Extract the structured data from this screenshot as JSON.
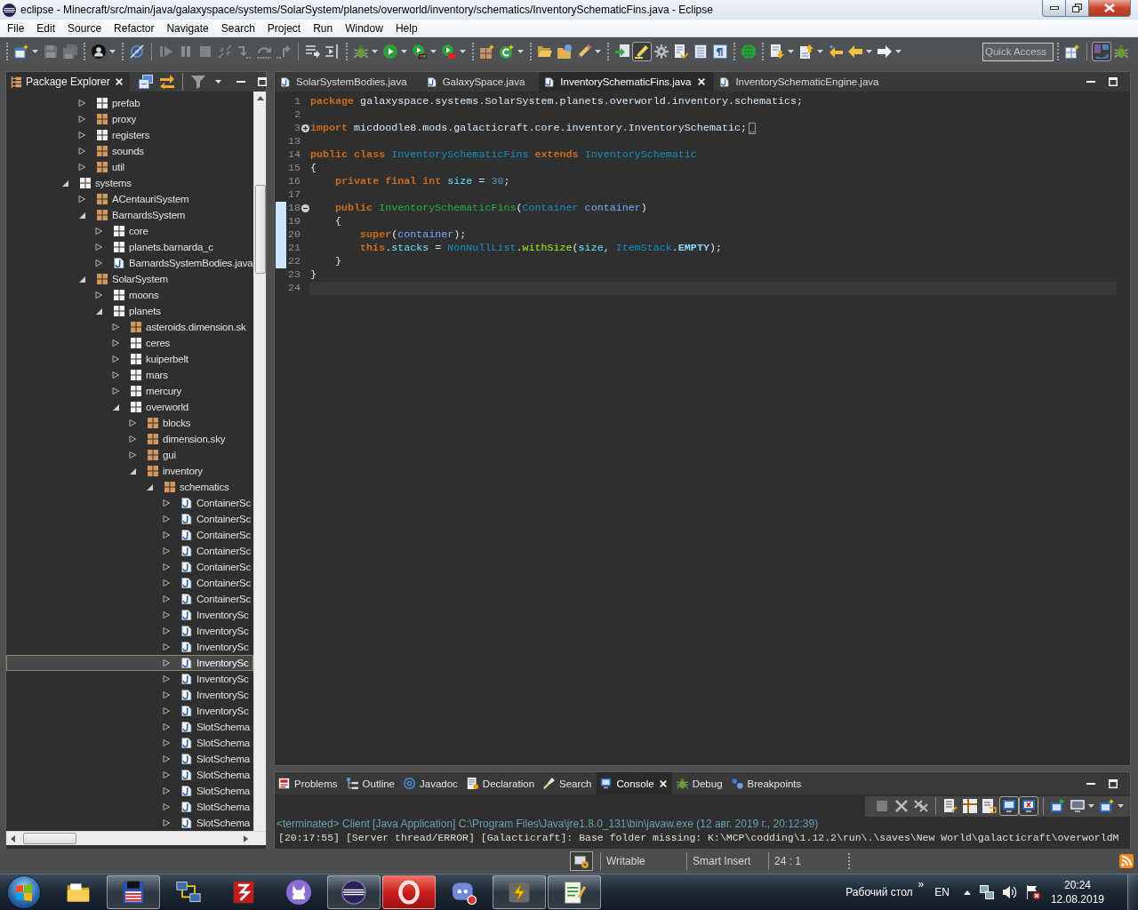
{
  "window": {
    "title": "eclipse - Minecraft/src/main/java/galaxyspace/systems/SolarSystem/planets/overworld/inventory/schematics/InventorySchematicFins.java - Eclipse"
  },
  "menu": [
    "File",
    "Edit",
    "Source",
    "Refactor",
    "Navigate",
    "Search",
    "Project",
    "Run",
    "Window",
    "Help"
  ],
  "toolbar": {
    "groups": [
      {
        "sections": [
          [
            {
              "kind": "newwizard",
              "disabled": false,
              "pressed": false,
              "dropdown": true
            },
            {
              "kind": "save",
              "disabled": true,
              "pressed": false,
              "dropdown": false
            },
            {
              "kind": "saveall",
              "disabled": true,
              "pressed": false,
              "dropdown": false
            }
          ]
        ]
      },
      {
        "sections": [
          [
            {
              "kind": "profile",
              "disabled": false,
              "pressed": false,
              "dropdown": true
            }
          ]
        ]
      },
      {
        "sections": [
          [
            {
              "kind": "skip",
              "disabled": false,
              "pressed": false,
              "dropdown": false
            }
          ],
          [
            {
              "kind": "resume",
              "disabled": true,
              "pressed": false,
              "dropdown": false
            },
            {
              "kind": "suspend",
              "disabled": true,
              "pressed": false,
              "dropdown": false
            },
            {
              "kind": "terminate",
              "disabled": true,
              "pressed": false,
              "dropdown": false
            },
            {
              "kind": "disconnect",
              "disabled": true,
              "pressed": false,
              "dropdown": false
            },
            {
              "kind": "stepinto",
              "disabled": true,
              "pressed": false,
              "dropdown": false
            },
            {
              "kind": "stepover",
              "disabled": true,
              "pressed": false,
              "dropdown": false
            },
            {
              "kind": "stepreturn",
              "disabled": true,
              "pressed": false,
              "dropdown": false
            }
          ],
          [
            {
              "kind": "dropframe",
              "disabled": false,
              "pressed": false,
              "dropdown": false
            },
            {
              "kind": "stepfilter",
              "disabled": false,
              "pressed": false,
              "dropdown": false
            }
          ]
        ]
      },
      {
        "sections": [
          [
            {
              "kind": "debug",
              "disabled": false,
              "pressed": false,
              "dropdown": true
            },
            {
              "kind": "run",
              "disabled": false,
              "pressed": false,
              "dropdown": true
            },
            {
              "kind": "coverage",
              "disabled": false,
              "pressed": false,
              "dropdown": true
            },
            {
              "kind": "external",
              "disabled": false,
              "pressed": false,
              "dropdown": true
            }
          ]
        ]
      },
      {
        "sections": [
          [
            {
              "kind": "newpackage",
              "disabled": false,
              "pressed": false,
              "dropdown": false
            },
            {
              "kind": "newclass",
              "disabled": false,
              "pressed": false,
              "dropdown": true
            }
          ]
        ]
      },
      {
        "sections": [
          [
            {
              "kind": "openfolder",
              "disabled": false,
              "pressed": false,
              "dropdown": false
            },
            {
              "kind": "opentype",
              "disabled": false,
              "pressed": false,
              "dropdown": false
            },
            {
              "kind": "pencil",
              "disabled": false,
              "pressed": false,
              "dropdown": true
            }
          ]
        ]
      },
      {
        "sections": [
          [
            {
              "kind": "breadcrumb",
              "disabled": false,
              "pressed": false,
              "dropdown": false
            },
            {
              "kind": "highlighter",
              "disabled": false,
              "pressed": true,
              "dropdown": false
            },
            {
              "kind": "blocks",
              "disabled": false,
              "pressed": false,
              "dropdown": false
            },
            {
              "kind": "doc",
              "disabled": false,
              "pressed": false,
              "dropdown": false
            },
            {
              "kind": "pagecolumns",
              "disabled": false,
              "pressed": false,
              "dropdown": false
            },
            {
              "kind": "paragraph",
              "disabled": false,
              "pressed": false,
              "dropdown": false
            }
          ]
        ]
      },
      {
        "sections": [
          [
            {
              "kind": "globe",
              "disabled": false,
              "pressed": false,
              "dropdown": false
            }
          ]
        ]
      },
      {
        "sections": [
          [
            {
              "kind": "nextann",
              "disabled": false,
              "pressed": false,
              "dropdown": true
            },
            {
              "kind": "prevann",
              "disabled": false,
              "pressed": false,
              "dropdown": true
            },
            {
              "kind": "lastedit",
              "disabled": false,
              "pressed": false,
              "dropdown": false
            },
            {
              "kind": "back",
              "disabled": false,
              "pressed": false,
              "dropdown": true
            },
            {
              "kind": "forward",
              "disabled": false,
              "pressed": false,
              "dropdown": true
            }
          ]
        ]
      }
    ],
    "quick_access": {
      "placeholder": "Quick Access"
    },
    "perspectives": [
      {
        "sections": [
          [
            {
              "kind": "perspective",
              "disabled": false,
              "pressed": false,
              "dropdown": false
            }
          ],
          [
            {
              "kind": "javaperspective",
              "disabled": false,
              "pressed": true,
              "dropdown": false
            },
            {
              "kind": "debugperspective",
              "disabled": false,
              "pressed": false,
              "dropdown": false
            }
          ]
        ]
      }
    ]
  },
  "package_explorer": {
    "title": "Package Explorer",
    "continued_items": [
      {
        "label": "prefab",
        "kind": "empty",
        "expanded": false,
        "selected": false
      },
      {
        "label": "proxy",
        "kind": "package",
        "expanded": false,
        "selected": false
      },
      {
        "label": "registers",
        "kind": "empty",
        "expanded": false,
        "selected": false
      },
      {
        "label": "sounds",
        "kind": "package",
        "expanded": false,
        "selected": false
      },
      {
        "label": "util",
        "kind": "package",
        "expanded": false,
        "selected": false
      }
    ],
    "tree": [
      {
        "label": "systems",
        "kind": "empty",
        "expanded": true,
        "selected": false,
        "children": [
          {
            "label": "ACentauriSystem",
            "kind": "package",
            "expanded": false,
            "selected": false
          },
          {
            "label": "BarnardsSystem",
            "kind": "package",
            "expanded": true,
            "selected": false,
            "children": [
              {
                "label": "core",
                "kind": "empty",
                "expanded": false,
                "selected": false
              },
              {
                "label": "planets.barnarda_c",
                "kind": "empty",
                "expanded": false,
                "selected": false
              },
              {
                "label": "BarnardsSystemBodies.java",
                "kind": "file",
                "expanded": false,
                "selected": false
              }
            ]
          },
          {
            "label": "SolarSystem",
            "kind": "package",
            "expanded": true,
            "selected": false,
            "children": [
              {
                "label": "moons",
                "kind": "empty",
                "expanded": false,
                "selected": false
              },
              {
                "label": "planets",
                "kind": "empty",
                "expanded": true,
                "selected": false,
                "children": [
                  {
                    "label": "asteroids.dimension.sk",
                    "kind": "package",
                    "expanded": false,
                    "selected": false
                  },
                  {
                    "label": "ceres",
                    "kind": "empty",
                    "expanded": false,
                    "selected": false
                  },
                  {
                    "label": "kuiperbelt",
                    "kind": "empty",
                    "expanded": false,
                    "selected": false
                  },
                  {
                    "label": "mars",
                    "kind": "empty",
                    "expanded": false,
                    "selected": false
                  },
                  {
                    "label": "mercury",
                    "kind": "empty",
                    "expanded": false,
                    "selected": false
                  },
                  {
                    "label": "overworld",
                    "kind": "empty",
                    "expanded": true,
                    "selected": false,
                    "children": [
                      {
                        "label": "blocks",
                        "kind": "package",
                        "expanded": false,
                        "selected": false
                      },
                      {
                        "label": "dimension.sky",
                        "kind": "package",
                        "expanded": false,
                        "selected": false
                      },
                      {
                        "label": "gui",
                        "kind": "package",
                        "expanded": false,
                        "selected": false
                      },
                      {
                        "label": "inventory",
                        "kind": "package",
                        "expanded": true,
                        "selected": false,
                        "children": [
                          {
                            "label": "schematics",
                            "kind": "package",
                            "expanded": true,
                            "selected": false,
                            "children": [
                              {
                                "label": "ContainerSc",
                                "kind": "file",
                                "expanded": false,
                                "selected": false
                              },
                              {
                                "label": "ContainerSc",
                                "kind": "file",
                                "expanded": false,
                                "selected": false
                              },
                              {
                                "label": "ContainerSc",
                                "kind": "file",
                                "expanded": false,
                                "selected": false
                              },
                              {
                                "label": "ContainerSc",
                                "kind": "file",
                                "expanded": false,
                                "selected": false
                              },
                              {
                                "label": "ContainerSc",
                                "kind": "file",
                                "expanded": false,
                                "selected": false
                              },
                              {
                                "label": "ContainerSc",
                                "kind": "file",
                                "expanded": false,
                                "selected": false
                              },
                              {
                                "label": "ContainerSc",
                                "kind": "file",
                                "expanded": false,
                                "selected": false
                              },
                              {
                                "label": "InventorySc",
                                "kind": "file",
                                "expanded": false,
                                "selected": false
                              },
                              {
                                "label": "InventorySc",
                                "kind": "file",
                                "expanded": false,
                                "selected": false
                              },
                              {
                                "label": "InventorySc",
                                "kind": "file",
                                "expanded": false,
                                "selected": false
                              },
                              {
                                "label": "InventorySc",
                                "kind": "file",
                                "expanded": false,
                                "selected": true
                              },
                              {
                                "label": "InventorySc",
                                "kind": "file",
                                "expanded": false,
                                "selected": false
                              },
                              {
                                "label": "InventorySc",
                                "kind": "file",
                                "expanded": false,
                                "selected": false
                              },
                              {
                                "label": "InventorySc",
                                "kind": "file",
                                "expanded": false,
                                "selected": false
                              },
                              {
                                "label": "SlotSchema",
                                "kind": "file",
                                "expanded": false,
                                "selected": false
                              },
                              {
                                "label": "SlotSchema",
                                "kind": "file",
                                "expanded": false,
                                "selected": false
                              },
                              {
                                "label": "SlotSchema",
                                "kind": "file",
                                "expanded": false,
                                "selected": false
                              },
                              {
                                "label": "SlotSchema",
                                "kind": "file",
                                "expanded": false,
                                "selected": false
                              },
                              {
                                "label": "SlotSchema",
                                "kind": "file",
                                "expanded": false,
                                "selected": false
                              },
                              {
                                "label": "SlotSchema",
                                "kind": "file",
                                "expanded": false,
                                "selected": false
                              },
                              {
                                "label": "SlotSchema",
                                "kind": "file",
                                "expanded": false,
                                "selected": false
                              }
                            ]
                          }
                        ]
                      }
                    ]
                  }
                ]
              }
            ]
          }
        ]
      }
    ]
  },
  "editor": {
    "tabs": [
      {
        "label": "SolarSystemBodies.java",
        "selected": false
      },
      {
        "label": "GalaxySpace.java",
        "selected": false
      },
      {
        "label": "InventorySchematicFins.java",
        "selected": true
      },
      {
        "label": "InventorySchematicEngine.java",
        "selected": false
      }
    ],
    "lines": [
      {
        "number": "1",
        "current": false,
        "range": false,
        "tokens": [
          {
            "kind": "keyword",
            "text": "package"
          },
          {
            "kind": "plain",
            "text": " galaxyspace.systems.SolarSystem.planets.overworld.inventory.schematics;"
          }
        ]
      },
      {
        "number": "2",
        "current": false,
        "range": false
      },
      {
        "number": "3",
        "current": false,
        "range": false,
        "fold": {
          "expanded": false
        },
        "tokens": [
          {
            "kind": "keyword",
            "text": "import"
          },
          {
            "kind": "plain",
            "text": " micdoodle8.mods.galacticraft.core.inventory.InventorySchematic;"
          }
        ]
      },
      {
        "number": "13",
        "current": false,
        "range": false
      },
      {
        "number": "14",
        "current": false,
        "range": false,
        "tokens": [
          {
            "kind": "keyword",
            "text": "public class "
          },
          {
            "kind": "type",
            "text": "InventorySchematicFins"
          },
          {
            "kind": "keyword",
            "text": " extends "
          },
          {
            "kind": "type",
            "text": "InventorySchematic"
          }
        ]
      },
      {
        "number": "15",
        "current": false,
        "range": false,
        "tokens": [
          {
            "kind": "plain",
            "text": "{"
          }
        ]
      },
      {
        "number": "16",
        "current": false,
        "range": false,
        "tokens": [
          {
            "kind": "keyword",
            "text": "    private final int "
          },
          {
            "kind": "field",
            "text": "size"
          },
          {
            "kind": "plain",
            "text": " = "
          },
          {
            "kind": "number",
            "text": "30"
          },
          {
            "kind": "plain",
            "text": ";"
          }
        ]
      },
      {
        "number": "17",
        "current": false,
        "range": false
      },
      {
        "number": "18",
        "current": false,
        "range": true,
        "fold": {
          "expanded": true
        },
        "tokens": [
          {
            "kind": "keyword",
            "text": "    public "
          },
          {
            "kind": "declaration",
            "text": "InventorySchematicFins"
          },
          {
            "kind": "plain",
            "text": "("
          },
          {
            "kind": "type",
            "text": "Container"
          },
          {
            "kind": "param",
            "text": " container"
          },
          {
            "kind": "plain",
            "text": ")"
          }
        ]
      },
      {
        "number": "19",
        "current": false,
        "range": true,
        "tokens": [
          {
            "kind": "plain",
            "text": "    {"
          }
        ]
      },
      {
        "number": "20",
        "current": false,
        "range": true,
        "tokens": [
          {
            "kind": "keyword",
            "text": "        super"
          },
          {
            "kind": "plain",
            "text": "("
          },
          {
            "kind": "param",
            "text": "container"
          },
          {
            "kind": "plain",
            "text": ");"
          }
        ]
      },
      {
        "number": "21",
        "current": false,
        "range": true,
        "tokens": [
          {
            "kind": "keyword",
            "text": "        this"
          },
          {
            "kind": "plain",
            "text": "."
          },
          {
            "kind": "field",
            "text": "stacks"
          },
          {
            "kind": "plain",
            "text": " = "
          },
          {
            "kind": "type",
            "text": "NonNullList"
          },
          {
            "kind": "plain",
            "text": "."
          },
          {
            "kind": "method",
            "text": "withSize"
          },
          {
            "kind": "plain",
            "text": "("
          },
          {
            "kind": "field",
            "text": "size"
          },
          {
            "kind": "plain",
            "text": ", "
          },
          {
            "kind": "type",
            "text": "ItemStack"
          },
          {
            "kind": "plain",
            "text": "."
          },
          {
            "kind": "constant",
            "text": "EMPTY"
          },
          {
            "kind": "plain",
            "text": ");"
          }
        ]
      },
      {
        "number": "22",
        "current": false,
        "range": true,
        "tokens": [
          {
            "kind": "plain",
            "text": "    }"
          }
        ]
      },
      {
        "number": "23",
        "current": false,
        "range": false,
        "tokens": [
          {
            "kind": "plain",
            "text": "}"
          }
        ]
      },
      {
        "number": "24",
        "current": true,
        "range": false
      }
    ]
  },
  "bottom_panel": {
    "tabs": [
      {
        "label": "Problems",
        "kind": "problems",
        "selected": false
      },
      {
        "label": "Outline",
        "kind": "outline",
        "selected": false
      },
      {
        "label": "Javadoc",
        "kind": "javadoc",
        "selected": false
      },
      {
        "label": "Declaration",
        "kind": "declaration",
        "selected": false
      },
      {
        "label": "Search",
        "kind": "search",
        "selected": false
      },
      {
        "label": "Console",
        "kind": "console",
        "selected": true
      },
      {
        "label": "Debug",
        "kind": "debug",
        "selected": false
      },
      {
        "label": "Breakpoints",
        "kind": "breakpoints",
        "selected": false
      }
    ],
    "console_toolbar": [
      [
        {
          "kind": "terminate",
          "disabled": true,
          "pressed": false,
          "dropdown": false
        },
        {
          "kind": "remove",
          "disabled": false,
          "pressed": false,
          "dropdown": false
        },
        {
          "kind": "removeall",
          "disabled": false,
          "pressed": false,
          "dropdown": false
        }
      ],
      [
        {
          "kind": "clear",
          "disabled": false,
          "pressed": false,
          "dropdown": false
        },
        {
          "kind": "scrolllock",
          "disabled": false,
          "pressed": false,
          "dropdown": false
        },
        {
          "kind": "wordwrap",
          "disabled": false,
          "pressed": false,
          "dropdown": false
        },
        {
          "kind": "stdout",
          "disabled": false,
          "pressed": true,
          "dropdown": false
        },
        {
          "kind": "stderr",
          "disabled": false,
          "pressed": true,
          "dropdown": false
        }
      ],
      [
        {
          "kind": "pin",
          "disabled": false,
          "pressed": false,
          "dropdown": false
        },
        {
          "kind": "display",
          "disabled": false,
          "pressed": false,
          "dropdown": true
        },
        {
          "kind": "newconsole",
          "disabled": false,
          "pressed": false,
          "dropdown": true
        }
      ]
    ],
    "console": {
      "header": "<terminated> Client [Java Application] C:\\Program Files\\Java\\jre1.8.0_131\\bin\\javaw.exe (12 авг. 2019 г., 20:12:39)",
      "output": "[20:17:55] [Server thread/ERROR] [Galacticraft]: Base folder missing: K:\\MCP\\codding\\1.12.2\\run\\.\\saves\\New World\\galacticraft\\overworldM"
    }
  },
  "status_bar": {
    "fields": [
      "Writable",
      "Smart Insert",
      "24 : 1"
    ]
  },
  "taskbar": {
    "apps": [
      {
        "kind": "explorer",
        "running": false,
        "flashing": false
      },
      {
        "kind": "floppy",
        "running": true,
        "flashing": false
      },
      {
        "kind": "network",
        "running": false,
        "flashing": false
      },
      {
        "kind": "filezilla",
        "running": false,
        "flashing": false
      },
      {
        "kind": "github",
        "running": false,
        "flashing": false
      },
      {
        "kind": "eclipse",
        "running": true,
        "flashing": false
      },
      {
        "kind": "opera",
        "running": true,
        "flashing": true
      },
      {
        "kind": "discord",
        "running": false,
        "flashing": false
      },
      {
        "kind": "bolt",
        "running": true,
        "flashing": false
      },
      {
        "kind": "notepad",
        "running": true,
        "flashing": false
      }
    ],
    "desktop_toolbar": "Рабочий стол",
    "chevron": "»",
    "language": "EN",
    "time": "20:24",
    "date": "12.08.2019"
  }
}
